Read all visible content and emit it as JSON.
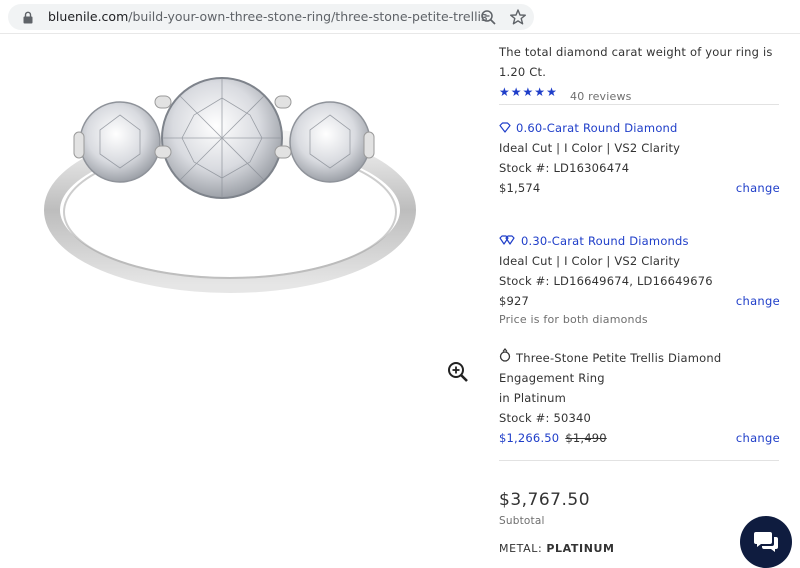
{
  "browser": {
    "url_host": "bluenile.com",
    "url_path": "/build-your-own-three-stone-ring/three-stone-petite-trellis..."
  },
  "summary": {
    "carat_text_line1": "The total diamond carat weight of your ring is",
    "carat_text_line2": "1.20 Ct.",
    "rating_stars": 5,
    "reviews": "40 reviews"
  },
  "center_diamond": {
    "title": "0.60-Carat Round Diamond",
    "specs": "Ideal Cut | I Color | VS2 Clarity",
    "stock": "Stock #: LD16306474",
    "price": "$1,574",
    "change": "change"
  },
  "side_diamonds": {
    "title": "0.30-Carat Round Diamonds",
    "specs": "Ideal Cut | I Color | VS2 Clarity",
    "stock": "Stock #: LD16649674,  LD16649676",
    "price": "$927",
    "note": "Price is for both diamonds",
    "change": "change"
  },
  "setting": {
    "title_line1": "Three-Stone Petite Trellis Diamond",
    "title_line2": "Engagement Ring",
    "metal_line": "in Platinum",
    "stock": "Stock #: 50340",
    "sale_price": "$1,266.50",
    "original_price": "$1,490",
    "change": "change"
  },
  "totals": {
    "subtotal": "$3,767.50",
    "subtotal_label": "Subtotal",
    "metal_label": "METAL:",
    "metal_value": "PLATINUM"
  },
  "colors": {
    "accent": "#1f3ec9",
    "chat_bg": "#0f1c3f"
  }
}
